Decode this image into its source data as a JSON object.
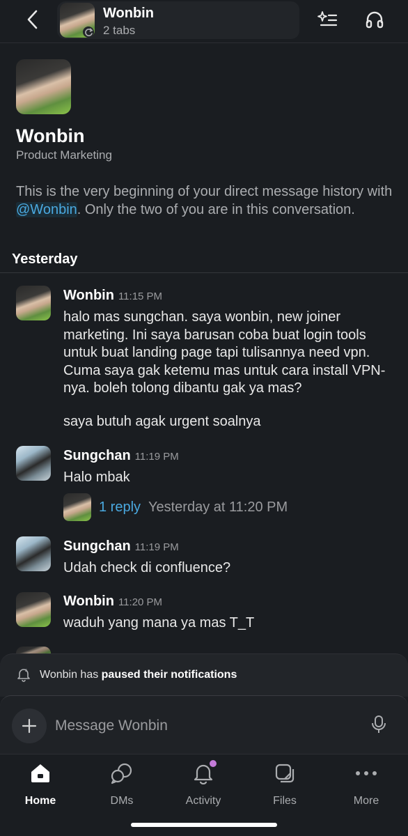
{
  "header": {
    "title": "Wonbin",
    "subtitle": "2 tabs",
    "icons": [
      "back-icon",
      "sparkle-list-icon",
      "headphones-icon",
      "refresh-icon"
    ]
  },
  "profile": {
    "name": "Wonbin",
    "role": "Product Marketing",
    "intro_before": "This is the very beginning of your direct message history with ",
    "intro_mention": "@Wonbin",
    "intro_after": ". Only the two of you are in this conversation."
  },
  "day_label": "Yesterday",
  "messages": [
    {
      "author": "Wonbin",
      "time": "11:15 PM",
      "text": "halo mas sungchan. saya wonbin, new joiner marketing. Ini saya barusan coba buat login tools untuk buat landing page tapi tulisannya need vpn. Cuma saya gak ketemu mas untuk cara install VPN-nya. boleh tolong dibantu gak ya mas?",
      "text2": "saya butuh agak urgent soalnya"
    },
    {
      "author": "Sungchan",
      "time": "11:19 PM",
      "text": "Halo mbak",
      "thread": {
        "count": "1 reply",
        "time": "Yesterday at 11:20 PM"
      }
    },
    {
      "author": "Sungchan",
      "time": "11:19 PM",
      "text": "Udah check di confluence?"
    },
    {
      "author": "Wonbin",
      "time": "11:20 PM",
      "text": "waduh yang mana ya mas T_T"
    }
  ],
  "notification": {
    "name": "Wonbin",
    "middle": " has ",
    "bold": "paused their notifications"
  },
  "composer": {
    "placeholder": "Message Wonbin"
  },
  "tabs": [
    {
      "label": "Home",
      "icon": "home-icon",
      "active": true
    },
    {
      "label": "DMs",
      "icon": "dms-icon",
      "active": false
    },
    {
      "label": "Activity",
      "icon": "bell-icon",
      "active": false,
      "badge": true
    },
    {
      "label": "Files",
      "icon": "files-icon",
      "active": false
    },
    {
      "label": "More",
      "icon": "more-icon",
      "active": false
    }
  ],
  "colors": {
    "background": "#1a1d21",
    "link": "#4aa9e0",
    "activity_badge": "#c47bd9"
  }
}
